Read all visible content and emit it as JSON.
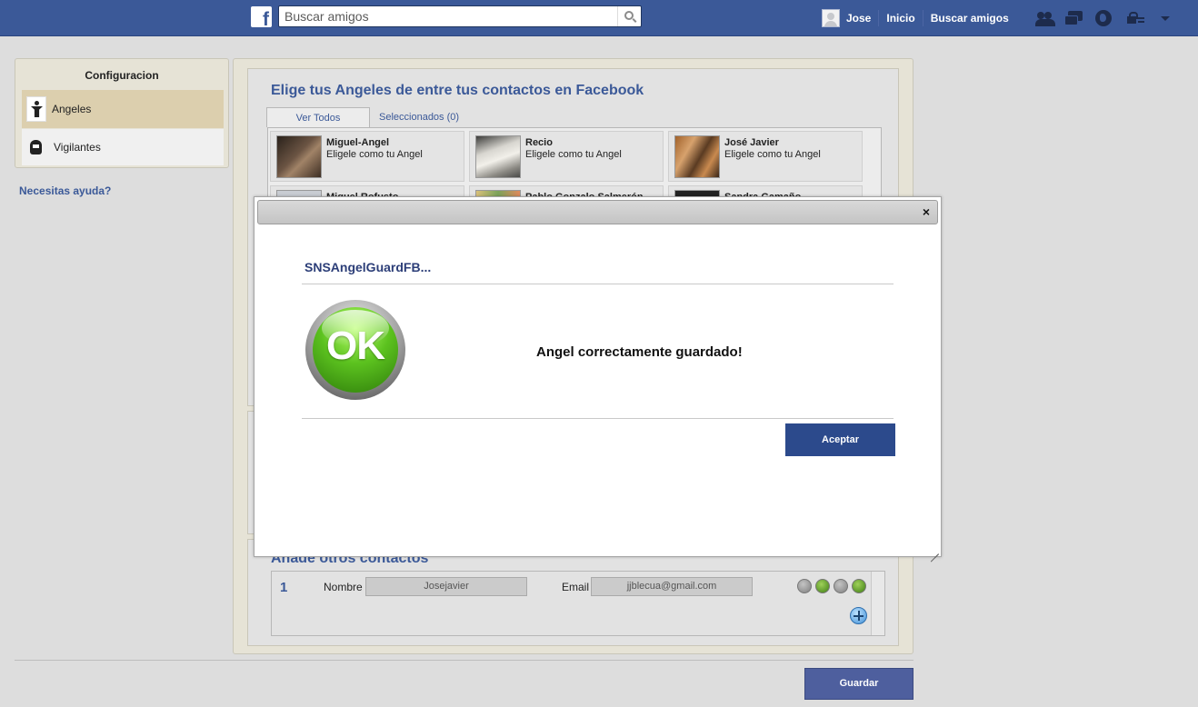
{
  "topbar": {
    "logo": "f",
    "search_placeholder": "Buscar amigos",
    "user_name": "Jose",
    "nav_home": "Inicio",
    "nav_find_friends": "Buscar amigos",
    "bg_color": "#3b5998"
  },
  "sidebar": {
    "title": "Configuracion",
    "items": [
      {
        "label": "Angeles",
        "icon": "angel-icon",
        "active": true
      },
      {
        "label": "Vigilantes",
        "icon": "spy-icon",
        "active": false
      }
    ],
    "help_link": "Necesitas ayuda?"
  },
  "main": {
    "title": "Elige tus Angeles de entre tus contactos en Facebook",
    "tabs": [
      {
        "label": "Ver Todos"
      },
      {
        "label": "Seleccionados (0)"
      }
    ],
    "contacts": [
      {
        "name": "Miguel-Angel",
        "subtitle": "Eligele como tu Angel"
      },
      {
        "name": "Recio",
        "subtitle": "Eligele como tu Angel"
      },
      {
        "name": "José Javier",
        "subtitle": "Eligele como tu Angel"
      },
      {
        "name": "Miguel Rofusto",
        "subtitle": ""
      },
      {
        "name": "Pablo Gonzalo Salmerón",
        "subtitle": ""
      },
      {
        "name": "Sandra Gamaño",
        "subtitle": ""
      }
    ],
    "others_title": "Añade otros contactos",
    "row": {
      "number": "1",
      "name_label": "Nombre",
      "name_value": "Josejavier",
      "email_label": "Email",
      "email_value": "jjblecua@gmail.com"
    },
    "save_button": "Guardar"
  },
  "modal": {
    "title": "SNSAngelGuardFB...",
    "ok_badge": "OK",
    "message": "Angel correctamente guardado!",
    "accept_button": "Aceptar",
    "close_glyph": "×"
  }
}
